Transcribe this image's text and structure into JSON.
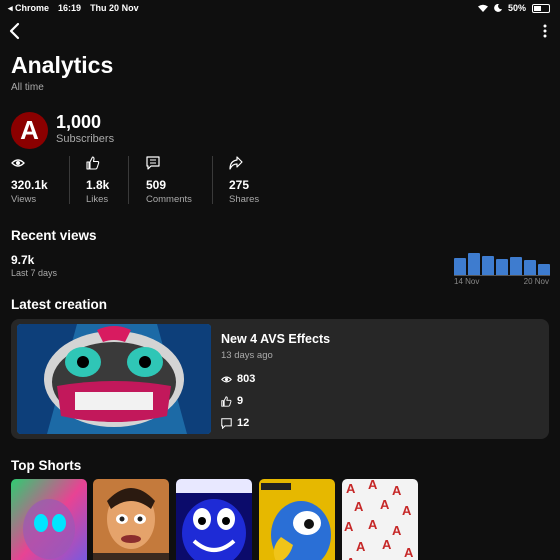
{
  "status_bar": {
    "back_app": "◂ Chrome",
    "time": "16:19",
    "date": "Thu 20 Nov",
    "battery": "50%"
  },
  "header": {
    "title": "Analytics",
    "range": "All time"
  },
  "channel": {
    "avatar_letter": "A",
    "subscribers": "1,000",
    "subscribers_label": "Subscribers"
  },
  "stats": [
    {
      "icon": "eye-icon",
      "value": "320.1k",
      "label": "Views"
    },
    {
      "icon": "thumbs-up-icon",
      "value": "1.8k",
      "label": "Likes"
    },
    {
      "icon": "comment-icon",
      "value": "509",
      "label": "Comments"
    },
    {
      "icon": "share-icon",
      "value": "275",
      "label": "Shares"
    }
  ],
  "recent_views": {
    "title": "Recent views",
    "value": "9.7k",
    "period": "Last 7 days",
    "start_date": "14 Nov",
    "end_date": "20 Nov",
    "bar_color": "#3e7ccf",
    "daily_levels": [
      0.72,
      0.92,
      0.78,
      0.65,
      0.75,
      0.63,
      0.45
    ]
  },
  "latest_creation": {
    "section_title": "Latest creation",
    "video_title": "New 4 AVS Effects",
    "ago": "13 days ago",
    "views": "803",
    "likes": "9",
    "comments": "12"
  },
  "top_shorts": {
    "title": "Top Shorts",
    "count": 5
  },
  "colors": {
    "background": "#0f0f0f",
    "card": "#272727",
    "avatar": "#8b0000",
    "muted_text": "#aaaaaa"
  }
}
